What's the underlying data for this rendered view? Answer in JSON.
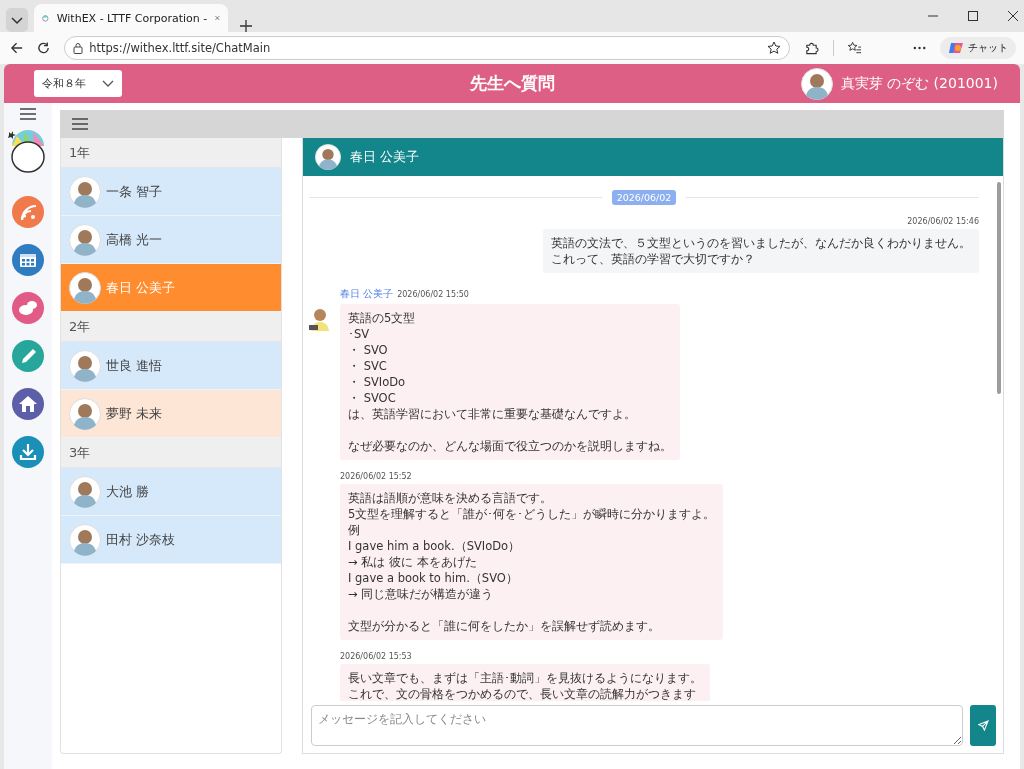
{
  "browser": {
    "tab_title": "WithEX - LTTF Corporation -",
    "url": "https://withex.lttf.site/ChatMain",
    "assistant_label": "チャット"
  },
  "header": {
    "era_select": {
      "value": "令和８年"
    },
    "title": "先生へ質問",
    "user": {
      "name": "真実芽 のぞむ (201001)"
    }
  },
  "side_menu": [
    {
      "kind": "feed"
    },
    {
      "kind": "calendar"
    },
    {
      "kind": "chat"
    },
    {
      "kind": "pencil"
    },
    {
      "kind": "home"
    },
    {
      "kind": "download"
    }
  ],
  "contacts": {
    "groups": [
      {
        "label": "1年",
        "members": [
          {
            "name": "一条 智子",
            "selected": false,
            "color": "#d5e9fb"
          },
          {
            "name": "高橋 光一",
            "selected": false,
            "color": "#d5e9fb"
          },
          {
            "name": "春日 公美子",
            "selected": true,
            "color": "#ff8c2e"
          }
        ]
      },
      {
        "label": "2年",
        "members": [
          {
            "name": "世良 進悟",
            "selected": false,
            "color": "#d5e9fb"
          },
          {
            "name": "夢野 未来",
            "selected": false,
            "color": "#fde6d6"
          }
        ]
      },
      {
        "label": "3年",
        "members": [
          {
            "name": "大池 勝",
            "selected": false,
            "color": "#d5e9fb"
          },
          {
            "name": "田村 沙奈枝",
            "selected": false,
            "color": "#d5e9fb"
          }
        ]
      }
    ]
  },
  "chat": {
    "partner": "春日 公美子",
    "date_divider": "2026/06/02",
    "messages": [
      {
        "kind": "sent",
        "time": "2026/06/02 15:46",
        "paragraphs": [
          [
            "英語の文法で、５文型というのを習いましたが、なんだか良くわかりません。",
            "これって、英語の学習で大切ですか？"
          ]
        ]
      },
      {
        "kind": "received",
        "sender": "春日 公美子",
        "time": "2026/06/02 15:50",
        "paragraphs": [
          [
            "英語の5文型",
            "･SV",
            "・ SVO",
            "・ SVC",
            "・ SVIoDo",
            "・ SVOC",
            "は、英語学習において非常に重要な基礎なんですよ。"
          ],
          [
            "なぜ必要なのか、どんな場面で役立つのかを説明しますね。"
          ]
        ]
      },
      {
        "kind": "received",
        "time": "2026/06/02 15:52",
        "paragraphs": [
          [
            "英語は語順が意味を決める言語です。",
            "5文型を理解すると「誰が･何を･どうした」が瞬時に分かりますよ。",
            "例",
            "I gave him a book.（SVIoDo）",
            "→ 私は 彼に 本をあげた",
            "I gave a book to him.（SVO）",
            "→ 同じ意味だが構造が違う"
          ],
          [
            "文型が分かると「誰に何をしたか」を誤解せず読めます。"
          ]
        ]
      },
      {
        "kind": "received",
        "time": "2026/06/02 15:53",
        "paragraphs": [
          [
            "長い文章でも、まずは「主語･動詞」を見抜けるようになります。",
            "これで、文の骨格をつかめるので、長い文章の読解力がつきます"
          ]
        ]
      }
    ],
    "composer": {
      "placeholder": "メッセージを記入してください"
    }
  }
}
